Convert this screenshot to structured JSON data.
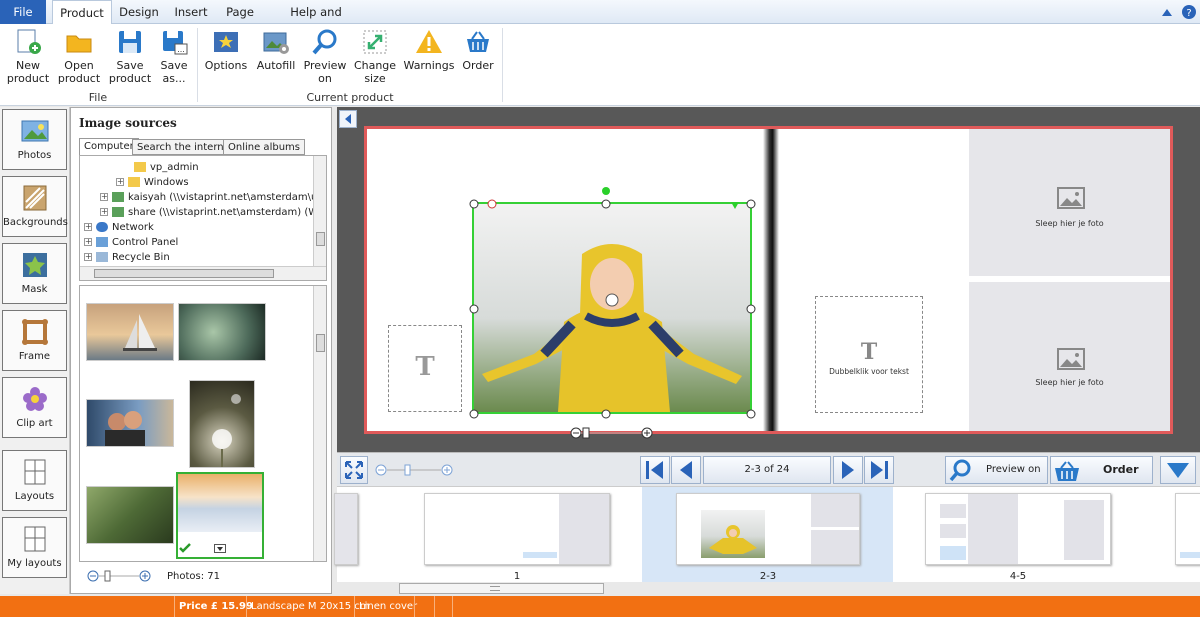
{
  "menu": {
    "tabs": [
      "File",
      "Product",
      "Design",
      "Insert",
      "Page",
      "Help and Options"
    ]
  },
  "ribbon": {
    "file_group": {
      "label": "File",
      "buttons": [
        {
          "line1": "New",
          "line2": "product"
        },
        {
          "line1": "Open",
          "line2": "product"
        },
        {
          "line1": "Save",
          "line2": "product"
        },
        {
          "line1": "Save",
          "line2": "as..."
        }
      ]
    },
    "current_group": {
      "label": "Current product",
      "buttons": [
        {
          "line1": "Options",
          "line2": ""
        },
        {
          "line1": "Autofill",
          "line2": ""
        },
        {
          "line1": "Preview",
          "line2": "on"
        },
        {
          "line1": "Change",
          "line2": "size"
        },
        {
          "line1": "Warnings",
          "line2": ""
        },
        {
          "line1": "Order",
          "line2": ""
        }
      ]
    }
  },
  "sidebar": {
    "items": [
      "Photos",
      "Backgrounds",
      "Mask",
      "Frame",
      "Clip art",
      "Layouts",
      "My layouts"
    ]
  },
  "sources": {
    "title": "Image sources",
    "tabs": [
      "Computer",
      "Search the internet",
      "Online albums"
    ],
    "tree": [
      "vp_admin",
      "Windows",
      "kaisyah (\\\\vistaprint.net\\amsterdam\\user)",
      "share (\\\\vistaprint.net\\amsterdam) (W:)",
      "Network",
      "Control Panel",
      "Recycle Bin"
    ],
    "photos_count": "Photos: 71"
  },
  "canvas": {
    "photo_placeholder": "Sleep hier je foto",
    "text_placeholder": "Dubbelklik voor tekst",
    "text_glyph": "T"
  },
  "nav": {
    "page_indicator": "2-3 of 24",
    "preview_label": "Preview on",
    "order_label": "Order"
  },
  "strip": {
    "labels": [
      "1",
      "2-3",
      "4-5"
    ]
  },
  "status": {
    "price": "Price £ 15.99",
    "format": "Landscape M 20x15 cm",
    "cover": "Linen cover"
  },
  "colors": {
    "accent": "#2a63b8",
    "status_bar": "#f27012",
    "selection": "#35d035",
    "spread_border": "#e05a5a"
  }
}
